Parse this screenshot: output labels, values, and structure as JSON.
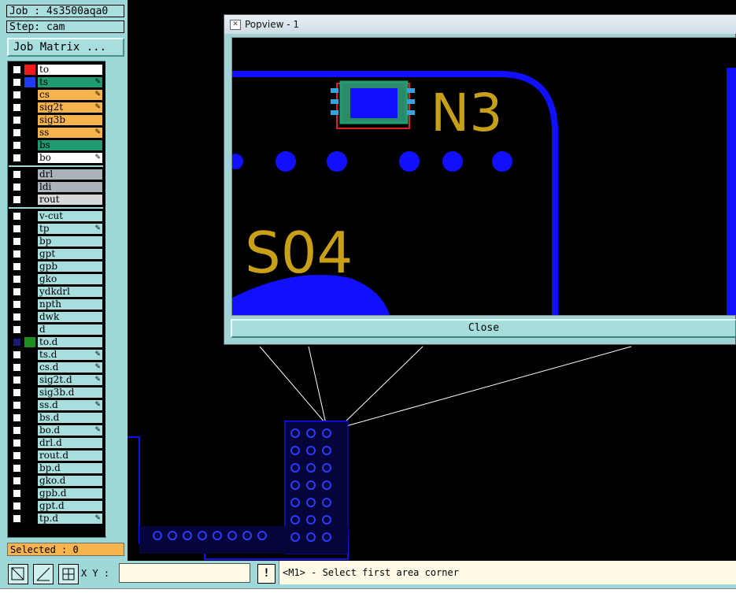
{
  "job": {
    "label": "Job : 4s3500aqa0",
    "step": "Step: cam"
  },
  "job_matrix_label": "Job Matrix ...",
  "layers": {
    "group1": [
      {
        "name": "to",
        "swatch": "#ee1c1c",
        "bg": "#ffffff",
        "pen": false
      },
      {
        "name": "ts",
        "swatch": "#1f3cf2",
        "bg": "#1f9a72",
        "pen": true
      },
      {
        "name": "cs",
        "swatch": "#000000",
        "bg": "#f7b44e",
        "pen": true
      },
      {
        "name": "sig2t",
        "swatch": "#000000",
        "bg": "#f7b44e",
        "pen": true
      },
      {
        "name": "sig3b",
        "swatch": "#000000",
        "bg": "#f7b44e",
        "pen": false
      },
      {
        "name": "ss",
        "swatch": "#000000",
        "bg": "#f7b44e",
        "pen": true
      },
      {
        "name": "bs",
        "swatch": "#000000",
        "bg": "#1f9a72",
        "pen": false
      },
      {
        "name": "bo",
        "swatch": "#000000",
        "bg": "#ffffff",
        "pen": true
      }
    ],
    "group2": [
      {
        "name": "drl",
        "swatch": "#000000",
        "bg": "#a9b3b9",
        "pen": false
      },
      {
        "name": "ldi",
        "swatch": "#000000",
        "bg": "#a9b3b9",
        "pen": false
      },
      {
        "name": "rout",
        "swatch": "#000000",
        "bg": "#d8d8d8",
        "pen": false
      }
    ],
    "group3": [
      {
        "name": "v-cut",
        "swatch": "#000000",
        "bg": "#a9dede",
        "pen": false
      },
      {
        "name": "tp",
        "swatch": "#000000",
        "bg": "#a9dede",
        "pen": true
      },
      {
        "name": "bp",
        "swatch": "#000000",
        "bg": "#a9dede",
        "pen": false
      },
      {
        "name": "gpt",
        "swatch": "#000000",
        "bg": "#a9dede",
        "pen": false
      },
      {
        "name": "gpb",
        "swatch": "#000000",
        "bg": "#a9dede",
        "pen": false
      },
      {
        "name": "gko",
        "swatch": "#000000",
        "bg": "#a9dede",
        "pen": false
      },
      {
        "name": "ydkdrl",
        "swatch": "#000000",
        "bg": "#a9dede",
        "pen": false
      },
      {
        "name": "npth",
        "swatch": "#000000",
        "bg": "#a9dede",
        "pen": false
      },
      {
        "name": "dwk",
        "swatch": "#000000",
        "bg": "#a9dede",
        "pen": false
      },
      {
        "name": "d",
        "swatch": "#000000",
        "bg": "#a9dede",
        "pen": false
      },
      {
        "name": "to.d",
        "swatch": "#1e8e1e",
        "bg": "#a9dede",
        "pen": false,
        "checked": true
      },
      {
        "name": "ts.d",
        "swatch": "#000000",
        "bg": "#a9dede",
        "pen": true
      },
      {
        "name": "cs.d",
        "swatch": "#000000",
        "bg": "#a9dede",
        "pen": true
      },
      {
        "name": "sig2t.d",
        "swatch": "#000000",
        "bg": "#a9dede",
        "pen": true
      },
      {
        "name": "sig3b.d",
        "swatch": "#000000",
        "bg": "#a9dede",
        "pen": false
      },
      {
        "name": "ss.d",
        "swatch": "#000000",
        "bg": "#a9dede",
        "pen": true
      },
      {
        "name": "bs.d",
        "swatch": "#000000",
        "bg": "#a9dede",
        "pen": false
      },
      {
        "name": "bo.d",
        "swatch": "#000000",
        "bg": "#a9dede",
        "pen": true
      },
      {
        "name": "drl.d",
        "swatch": "#000000",
        "bg": "#a9dede",
        "pen": false
      },
      {
        "name": "rout.d",
        "swatch": "#000000",
        "bg": "#a9dede",
        "pen": false
      },
      {
        "name": "bp.d",
        "swatch": "#000000",
        "bg": "#a9dede",
        "pen": false
      },
      {
        "name": "gko.d",
        "swatch": "#000000",
        "bg": "#a9dede",
        "pen": false
      },
      {
        "name": "gpb.d",
        "swatch": "#000000",
        "bg": "#a9dede",
        "pen": false
      },
      {
        "name": "gpt.d",
        "swatch": "#000000",
        "bg": "#a9dede",
        "pen": false
      },
      {
        "name": "tp.d",
        "swatch": "#000000",
        "bg": "#a9dede",
        "pen": true
      }
    ]
  },
  "selected_label": "Selected : 0",
  "toolbar": {
    "xy_label": "X Y :",
    "xy_value": "",
    "bang": "!"
  },
  "status_message": "<M1> - Select first area corner",
  "popview": {
    "title": "Popview - 1",
    "close_label": "Close",
    "labels": {
      "n3": "N3",
      "s04": "S04"
    }
  },
  "colors": {
    "panel": "#9fd8d8",
    "pcb_blue": "#1010ff",
    "silk": "#c8a018",
    "status_bg": "#fffbe6"
  }
}
